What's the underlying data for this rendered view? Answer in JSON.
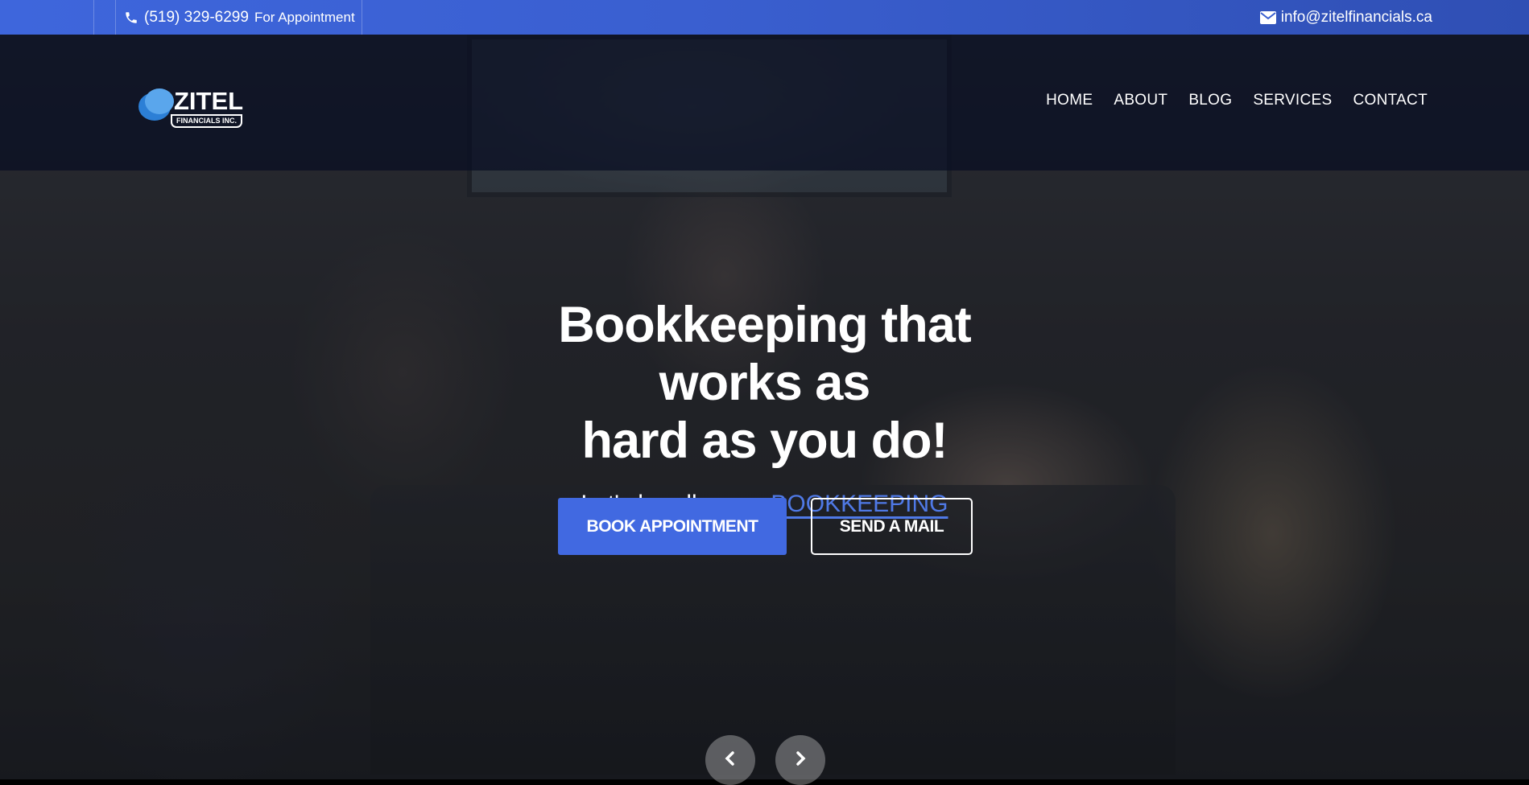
{
  "topbar": {
    "phone_number": "(519) 329-6299",
    "phone_note": "For Appointment",
    "email": "info@zitelfinancials.ca",
    "icons": [
      "phone-icon",
      "envelope-icon"
    ]
  },
  "brand": {
    "name": "ZITEL",
    "tagline": "FINANCIALS INC."
  },
  "nav": {
    "items": [
      {
        "label": "HOME"
      },
      {
        "label": "ABOUT"
      },
      {
        "label": "BLOG"
      },
      {
        "label": "SERVICES"
      },
      {
        "label": "CONTACT"
      }
    ]
  },
  "hero": {
    "headline_line1": "Bookkeeping that works as",
    "headline_line2": "hard as you do!",
    "sub_prefix": "Let's handle your",
    "sub_highlight": "BOOKKEEPING",
    "primary_button": "BOOK APPOINTMENT",
    "secondary_button": "SEND A MAIL"
  },
  "carousel": {
    "icons": [
      "chevron-left-icon",
      "chevron-right-icon"
    ]
  },
  "colors": {
    "accent": "#4169e1",
    "topbar": "#3a5fd0",
    "highlight": "#4f79e6"
  }
}
